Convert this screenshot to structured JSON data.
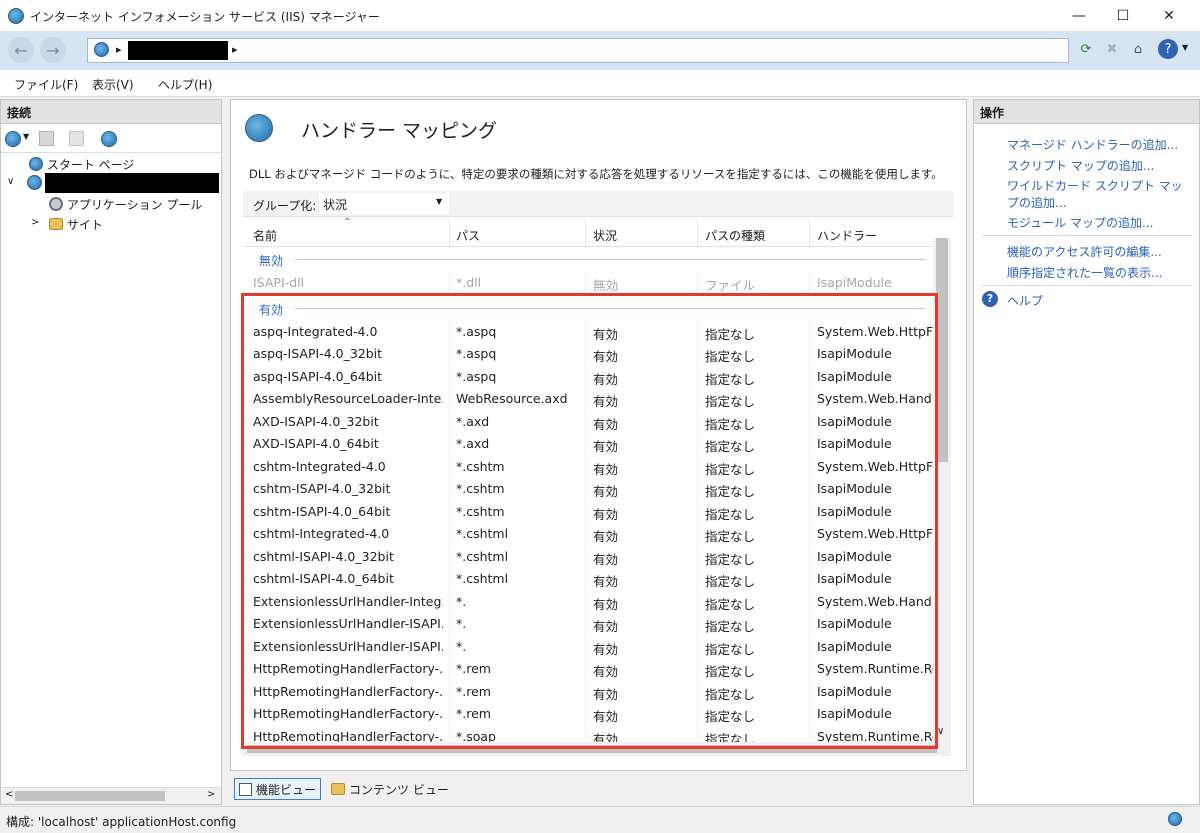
{
  "window": {
    "title": "インターネット インフォメーション サービス (IIS) マネージャー"
  },
  "menu": [
    "ファイル(F)",
    "表示(V)",
    "ヘルプ(H)"
  ],
  "address": {
    "separator": "▸"
  },
  "connections": {
    "title": "接続",
    "tree": {
      "start_page": "スタート ページ",
      "app_pools": "アプリケーション プール",
      "sites": "サイト"
    }
  },
  "feature": {
    "title": "ハンドラー マッピング",
    "description": "DLL およびマネージド コードのように、特定の要求の種類に対する応答を処理するリソースを指定するには、この機能を使用します。",
    "groupby_label": "グループ化:",
    "groupby_value": "状況"
  },
  "grid": {
    "headers": [
      "名前",
      "パス",
      "状況",
      "パスの種類",
      "ハンドラー"
    ],
    "groups": [
      {
        "label": "無効",
        "rows": [
          [
            "ISAPI-dll",
            "*.dll",
            "無効",
            "ファイル",
            "IsapiModule"
          ]
        ]
      },
      {
        "label": "有効",
        "rows": [
          [
            "aspq-Integrated-4.0",
            "*.aspq",
            "有効",
            "指定なし",
            "System.Web.HttpFc"
          ],
          [
            "aspq-ISAPI-4.0_32bit",
            "*.aspq",
            "有効",
            "指定なし",
            "IsapiModule"
          ],
          [
            "aspq-ISAPI-4.0_64bit",
            "*.aspq",
            "有効",
            "指定なし",
            "IsapiModule"
          ],
          [
            "AssemblyResourceLoader-Inte...",
            "WebResource.axd",
            "有効",
            "指定なし",
            "System.Web.Handle"
          ],
          [
            "AXD-ISAPI-4.0_32bit",
            "*.axd",
            "有効",
            "指定なし",
            "IsapiModule"
          ],
          [
            "AXD-ISAPI-4.0_64bit",
            "*.axd",
            "有効",
            "指定なし",
            "IsapiModule"
          ],
          [
            "cshtm-Integrated-4.0",
            "*.cshtm",
            "有効",
            "指定なし",
            "System.Web.HttpFc"
          ],
          [
            "cshtm-ISAPI-4.0_32bit",
            "*.cshtm",
            "有効",
            "指定なし",
            "IsapiModule"
          ],
          [
            "cshtm-ISAPI-4.0_64bit",
            "*.cshtm",
            "有効",
            "指定なし",
            "IsapiModule"
          ],
          [
            "cshtml-Integrated-4.0",
            "*.cshtml",
            "有効",
            "指定なし",
            "System.Web.HttpFc"
          ],
          [
            "cshtml-ISAPI-4.0_32bit",
            "*.cshtml",
            "有効",
            "指定なし",
            "IsapiModule"
          ],
          [
            "cshtml-ISAPI-4.0_64bit",
            "*.cshtml",
            "有効",
            "指定なし",
            "IsapiModule"
          ],
          [
            "ExtensionlessUrlHandler-Integ...",
            "*.",
            "有効",
            "指定なし",
            "System.Web.Handle"
          ],
          [
            "ExtensionlessUrlHandler-ISAPI...",
            "*.",
            "有効",
            "指定なし",
            "IsapiModule"
          ],
          [
            "ExtensionlessUrlHandler-ISAPI...",
            "*.",
            "有効",
            "指定なし",
            "IsapiModule"
          ],
          [
            "HttpRemotingHandlerFactory-...",
            "*.rem",
            "有効",
            "指定なし",
            "System.Runtime.Rer"
          ],
          [
            "HttpRemotingHandlerFactory-...",
            "*.rem",
            "有効",
            "指定なし",
            "IsapiModule"
          ],
          [
            "HttpRemotingHandlerFactory-...",
            "*.rem",
            "有効",
            "指定なし",
            "IsapiModule"
          ],
          [
            "HttpRemotingHandlerFactory-...",
            "*.soap",
            "有効",
            "指定なし",
            "System.Runtime.Rer"
          ]
        ]
      }
    ]
  },
  "views": {
    "features": "機能ビュー",
    "content": "コンテンツ ビュー"
  },
  "actions": {
    "title": "操作",
    "group1": [
      "マネージド ハンドラーの追加...",
      "スクリプト マップの追加...",
      "ワイルドカード スクリプト マップの追加...",
      "モジュール マップの追加..."
    ],
    "group2": [
      "機能のアクセス許可の編集...",
      "順序指定された一覧の表示..."
    ],
    "help": "ヘルプ"
  },
  "status": {
    "text": "構成: 'localhost' applicationHost.config"
  },
  "colors": {
    "highlight": "#e03a2a",
    "link": "#2a62b8",
    "group": "#3266c8"
  }
}
